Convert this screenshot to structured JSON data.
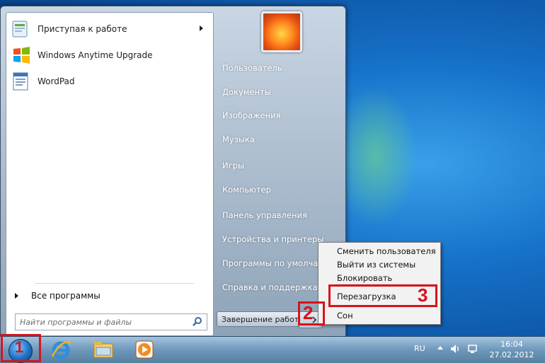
{
  "start_menu": {
    "programs": [
      {
        "label": "Приступая к работе",
        "icon": "getting-started-icon",
        "has_submenu": true
      },
      {
        "label": "Windows Anytime Upgrade",
        "icon": "windows-flag-icon",
        "has_submenu": false
      },
      {
        "label": "WordPad",
        "icon": "wordpad-icon",
        "has_submenu": false
      }
    ],
    "all_programs_label": "Все программы",
    "search_placeholder": "Найти программы и файлы",
    "right_items": [
      "Пользователь",
      "Документы",
      "Изображения",
      "Музыка",
      "Игры",
      "Компьютер",
      "Панель управления",
      "Устройства и принтеры",
      "Программы по умолчанию",
      "Справка и поддержка"
    ],
    "shutdown_label": "Завершение работы"
  },
  "power_menu": {
    "items": [
      "Сменить пользователя",
      "Выйти из системы",
      "Блокировать",
      "Перезагрузка",
      "Сон"
    ]
  },
  "annotations": {
    "step1": "1",
    "step2": "2",
    "step3": "3",
    "color": "#d8131b"
  },
  "taskbar": {
    "language": "RU",
    "time": "16:04",
    "date": "27.02.2012",
    "pinned": [
      "internet-explorer-icon",
      "explorer-folder-icon",
      "media-player-icon"
    ]
  }
}
